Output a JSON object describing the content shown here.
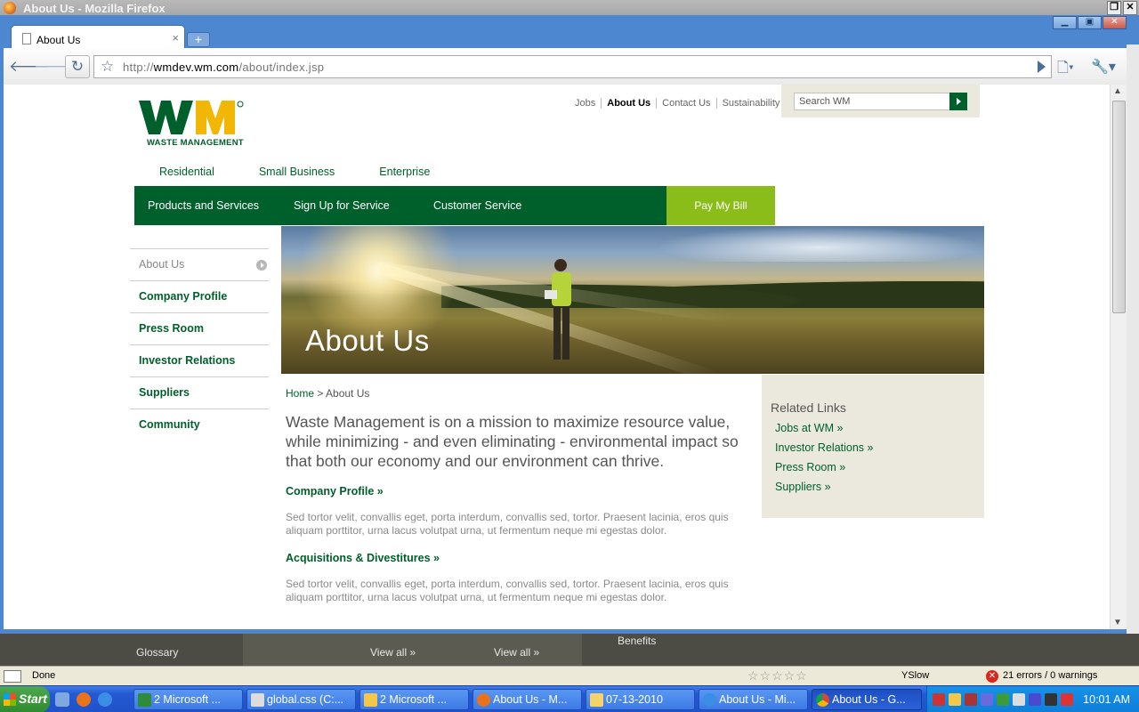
{
  "firefox": {
    "title": "About Us - Mozilla Firefox"
  },
  "browser": {
    "tab_label": "About Us",
    "url_prefix": "http://",
    "url_domain": "wmdev.wm.com",
    "url_path": "/about/index.jsp"
  },
  "header": {
    "logo_tagline": "WASTE MANAGEMENT",
    "util_nav": [
      "Jobs",
      "About Us",
      "Contact Us",
      "Sustainability"
    ],
    "search_placeholder": "Search WM",
    "segments": [
      "Residential",
      "Small Business",
      "Enterprise"
    ],
    "main_nav": [
      "Products and Services",
      "Sign Up for Service",
      "Customer Service"
    ],
    "pay_bill": "Pay My Bill"
  },
  "sidebar": {
    "items": [
      "About Us",
      "Company Profile",
      "Press Room",
      "Investor Relations",
      "Suppliers",
      "Community"
    ]
  },
  "hero": {
    "title": "About Us"
  },
  "content": {
    "breadcrumb_home": "Home",
    "breadcrumb_sep": " > ",
    "breadcrumb_current": "About Us",
    "intro": "Waste Management is on a mission to maximize resource value, while minimizing - and even eliminating - environmental impact so that both our economy and our environment can thrive.",
    "sections": [
      {
        "heading": "Company Profile »",
        "body": "Sed tortor velit, convallis eget, porta interdum, convallis sed, tortor. Praesent lacinia, eros quis aliquam porttitor, urna lacus volutpat urna, ut fermentum neque mi egestas dolor."
      },
      {
        "heading": "Acquisitions & Divestitures »",
        "body": "Sed tortor velit, convallis eget, porta interdum, convallis sed, tortor. Praesent lacinia, eros quis aliquam porttitor, urna lacus volutpat urna, ut fermentum neque mi egestas dolor."
      }
    ]
  },
  "related": {
    "heading": "Related Links",
    "links": [
      "Jobs at WM »",
      "Investor Relations »",
      "Press Room »",
      "Suppliers »"
    ]
  },
  "footer": {
    "glossary": "Glossary",
    "view_all_1": "View all »",
    "view_all_2": "View all »",
    "benefits": "Benefits"
  },
  "statusbar": {
    "status": "Done",
    "yslow": "YSlow",
    "errors": "21 errors / 0 warnings"
  },
  "taskbar": {
    "start": "Start",
    "buttons": [
      "2 Microsoft ...",
      "global.css (C:...",
      "2 Microsoft ...",
      "About Us - M...",
      "07-13-2010",
      "About Us - Mi...",
      "About Us - G..."
    ],
    "clock": "10:01 AM"
  },
  "colors": {
    "brand_green": "#00602b",
    "accent_lime": "#8bbd1a",
    "logo_yellow": "#f2b705",
    "panel_beige": "#ebe9dd"
  }
}
